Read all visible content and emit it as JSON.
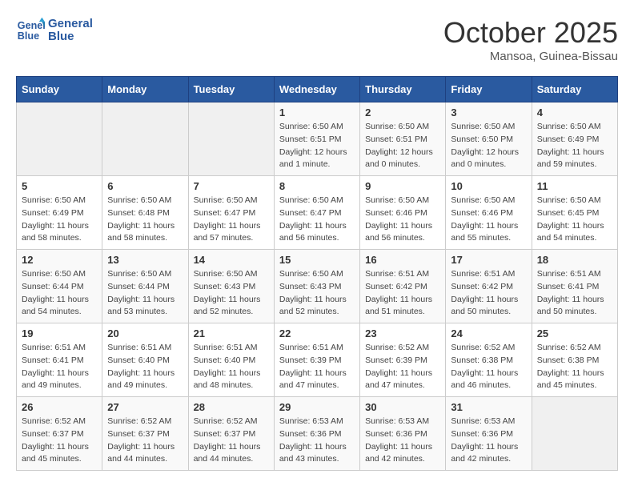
{
  "logo": {
    "line1": "General",
    "line2": "Blue"
  },
  "title": "October 2025",
  "location": "Mansoa, Guinea-Bissau",
  "days_header": [
    "Sunday",
    "Monday",
    "Tuesday",
    "Wednesday",
    "Thursday",
    "Friday",
    "Saturday"
  ],
  "weeks": [
    [
      {
        "day": "",
        "info": ""
      },
      {
        "day": "",
        "info": ""
      },
      {
        "day": "",
        "info": ""
      },
      {
        "day": "1",
        "info": "Sunrise: 6:50 AM\nSunset: 6:51 PM\nDaylight: 12 hours\nand 1 minute."
      },
      {
        "day": "2",
        "info": "Sunrise: 6:50 AM\nSunset: 6:51 PM\nDaylight: 12 hours\nand 0 minutes."
      },
      {
        "day": "3",
        "info": "Sunrise: 6:50 AM\nSunset: 6:50 PM\nDaylight: 12 hours\nand 0 minutes."
      },
      {
        "day": "4",
        "info": "Sunrise: 6:50 AM\nSunset: 6:49 PM\nDaylight: 11 hours\nand 59 minutes."
      }
    ],
    [
      {
        "day": "5",
        "info": "Sunrise: 6:50 AM\nSunset: 6:49 PM\nDaylight: 11 hours\nand 58 minutes."
      },
      {
        "day": "6",
        "info": "Sunrise: 6:50 AM\nSunset: 6:48 PM\nDaylight: 11 hours\nand 58 minutes."
      },
      {
        "day": "7",
        "info": "Sunrise: 6:50 AM\nSunset: 6:47 PM\nDaylight: 11 hours\nand 57 minutes."
      },
      {
        "day": "8",
        "info": "Sunrise: 6:50 AM\nSunset: 6:47 PM\nDaylight: 11 hours\nand 56 minutes."
      },
      {
        "day": "9",
        "info": "Sunrise: 6:50 AM\nSunset: 6:46 PM\nDaylight: 11 hours\nand 56 minutes."
      },
      {
        "day": "10",
        "info": "Sunrise: 6:50 AM\nSunset: 6:46 PM\nDaylight: 11 hours\nand 55 minutes."
      },
      {
        "day": "11",
        "info": "Sunrise: 6:50 AM\nSunset: 6:45 PM\nDaylight: 11 hours\nand 54 minutes."
      }
    ],
    [
      {
        "day": "12",
        "info": "Sunrise: 6:50 AM\nSunset: 6:44 PM\nDaylight: 11 hours\nand 54 minutes."
      },
      {
        "day": "13",
        "info": "Sunrise: 6:50 AM\nSunset: 6:44 PM\nDaylight: 11 hours\nand 53 minutes."
      },
      {
        "day": "14",
        "info": "Sunrise: 6:50 AM\nSunset: 6:43 PM\nDaylight: 11 hours\nand 52 minutes."
      },
      {
        "day": "15",
        "info": "Sunrise: 6:50 AM\nSunset: 6:43 PM\nDaylight: 11 hours\nand 52 minutes."
      },
      {
        "day": "16",
        "info": "Sunrise: 6:51 AM\nSunset: 6:42 PM\nDaylight: 11 hours\nand 51 minutes."
      },
      {
        "day": "17",
        "info": "Sunrise: 6:51 AM\nSunset: 6:42 PM\nDaylight: 11 hours\nand 50 minutes."
      },
      {
        "day": "18",
        "info": "Sunrise: 6:51 AM\nSunset: 6:41 PM\nDaylight: 11 hours\nand 50 minutes."
      }
    ],
    [
      {
        "day": "19",
        "info": "Sunrise: 6:51 AM\nSunset: 6:41 PM\nDaylight: 11 hours\nand 49 minutes."
      },
      {
        "day": "20",
        "info": "Sunrise: 6:51 AM\nSunset: 6:40 PM\nDaylight: 11 hours\nand 49 minutes."
      },
      {
        "day": "21",
        "info": "Sunrise: 6:51 AM\nSunset: 6:40 PM\nDaylight: 11 hours\nand 48 minutes."
      },
      {
        "day": "22",
        "info": "Sunrise: 6:51 AM\nSunset: 6:39 PM\nDaylight: 11 hours\nand 47 minutes."
      },
      {
        "day": "23",
        "info": "Sunrise: 6:52 AM\nSunset: 6:39 PM\nDaylight: 11 hours\nand 47 minutes."
      },
      {
        "day": "24",
        "info": "Sunrise: 6:52 AM\nSunset: 6:38 PM\nDaylight: 11 hours\nand 46 minutes."
      },
      {
        "day": "25",
        "info": "Sunrise: 6:52 AM\nSunset: 6:38 PM\nDaylight: 11 hours\nand 45 minutes."
      }
    ],
    [
      {
        "day": "26",
        "info": "Sunrise: 6:52 AM\nSunset: 6:37 PM\nDaylight: 11 hours\nand 45 minutes."
      },
      {
        "day": "27",
        "info": "Sunrise: 6:52 AM\nSunset: 6:37 PM\nDaylight: 11 hours\nand 44 minutes."
      },
      {
        "day": "28",
        "info": "Sunrise: 6:52 AM\nSunset: 6:37 PM\nDaylight: 11 hours\nand 44 minutes."
      },
      {
        "day": "29",
        "info": "Sunrise: 6:53 AM\nSunset: 6:36 PM\nDaylight: 11 hours\nand 43 minutes."
      },
      {
        "day": "30",
        "info": "Sunrise: 6:53 AM\nSunset: 6:36 PM\nDaylight: 11 hours\nand 42 minutes."
      },
      {
        "day": "31",
        "info": "Sunrise: 6:53 AM\nSunset: 6:36 PM\nDaylight: 11 hours\nand 42 minutes."
      },
      {
        "day": "",
        "info": ""
      }
    ]
  ]
}
